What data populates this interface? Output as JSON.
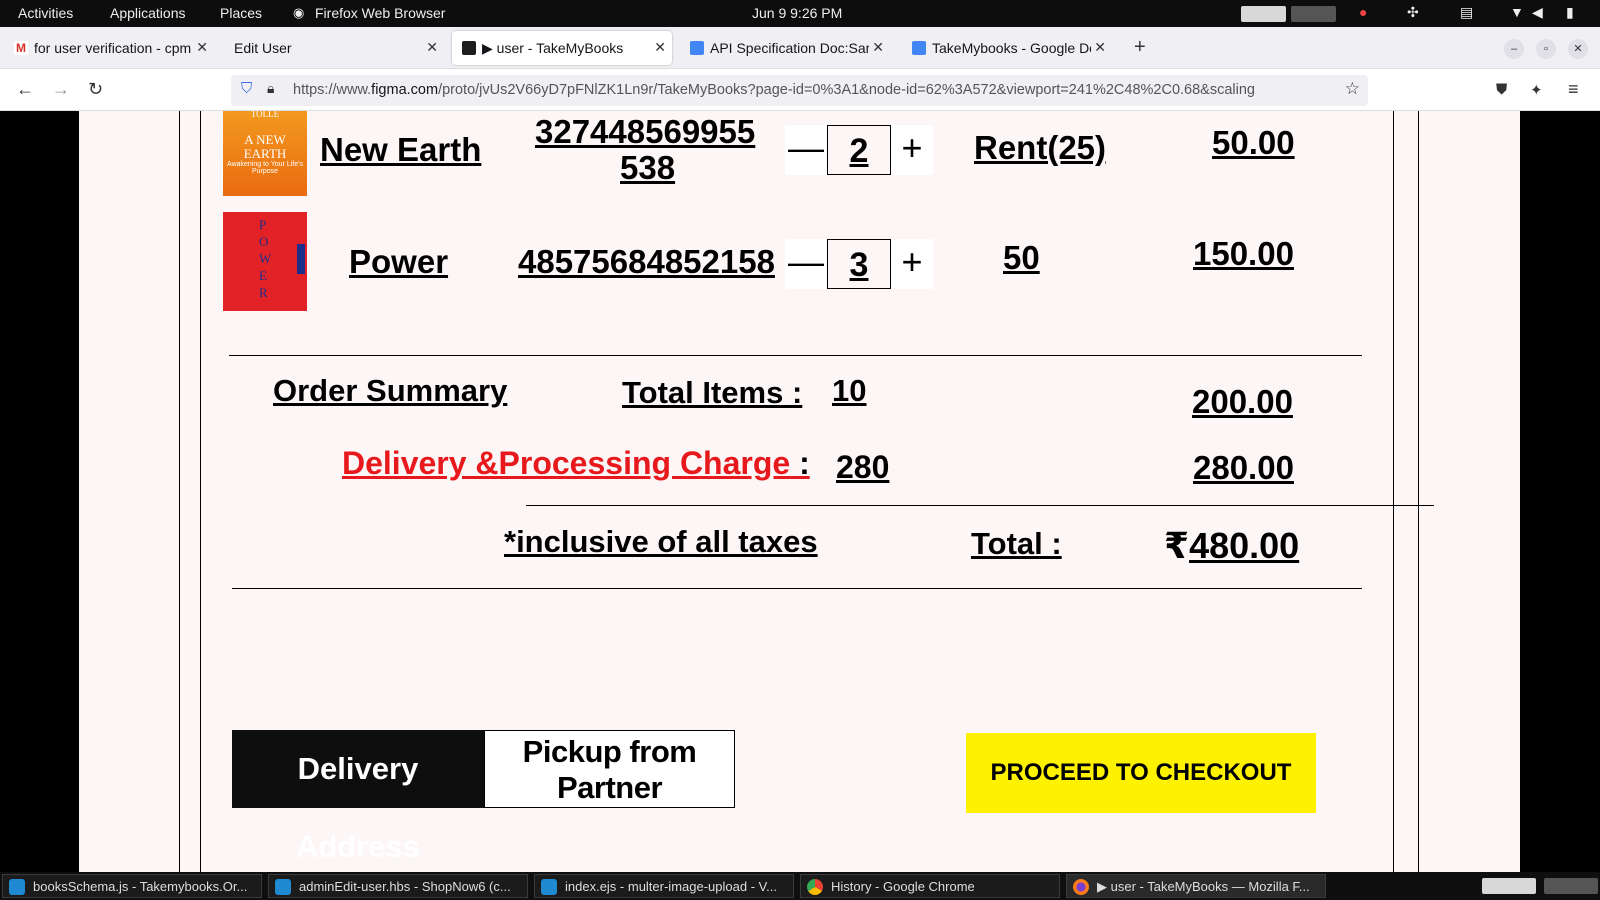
{
  "topbar": {
    "activities": "Activities",
    "applications": "Applications",
    "places": "Places",
    "app_name": "Firefox Web Browser",
    "datetime": "Jun 9  9:26 PM"
  },
  "tabs": [
    {
      "label": "for user verification - cpm",
      "icon": "gmail-icon"
    },
    {
      "label": "Edit User",
      "icon": ""
    },
    {
      "label": "▶ user - TakeMyBooks",
      "icon": "figma-icon"
    },
    {
      "label": "API Specification Doc:Sam",
      "icon": "google-docs-icon"
    },
    {
      "label": "TakeMybooks - Google Do",
      "icon": "google-docs-icon"
    }
  ],
  "navbar": {
    "url_prefix": "https://www.",
    "url_domain": "figma.com",
    "url_rest": "/proto/jvUs2V66yD7pFNlZK1Ln9r/TakeMyBooks?page-id=0%3A1&node-id=62%3A572&viewport=241%2C48%2C0.68&scaling"
  },
  "cart": {
    "items": [
      {
        "title": "New Earth",
        "isbn_line1": "327448569955",
        "isbn_line2": "538",
        "qty": "2",
        "price_label": "Rent(25)",
        "amount": "50.00",
        "cover": {
          "top": "TOLLE",
          "title": "A NEW EARTH",
          "sub": "Awakening to Your Life's Purpose"
        }
      },
      {
        "title": "Power",
        "isbn_line1": "48575684852158",
        "qty": "3",
        "price_label": "50",
        "amount": "150.00",
        "cover": {
          "title": "POWER"
        }
      }
    ],
    "minus": "—",
    "plus": "+"
  },
  "summary": {
    "heading": "Order Summary",
    "total_items_label": "Total Items :",
    "total_items_value": "10",
    "items_amount": "200.00",
    "delivery_label": "Delivery &Processing  Charge",
    "delivery_colon": " :",
    "delivery_value": "280",
    "delivery_amount": "280.00",
    "taxes_note": "*inclusive of all taxes",
    "total_label": "Total :",
    "total_currency": "₹",
    "total_amount": "480.00",
    "delivery_color": "#e8191d"
  },
  "actions": {
    "delivery_address": "Delivery Address",
    "pickup_line1": "Pickup from",
    "pickup_line2": "Partner",
    "checkout": "PROCEED TO CHECKOUT",
    "checkout_color": "#fff200"
  },
  "taskbar": [
    {
      "label": "booksSchema.js - Takemybooks.Or...",
      "icon": "vscode-icon"
    },
    {
      "label": "adminEdit-user.hbs - ShopNow6 (c...",
      "icon": "vscode-icon"
    },
    {
      "label": "index.ejs - multer-image-upload - V...",
      "icon": "vscode-icon"
    },
    {
      "label": "History - Google Chrome",
      "icon": "chrome-icon"
    },
    {
      "label": "▶ user - TakeMyBooks — Mozilla F...",
      "icon": "firefox-icon"
    }
  ]
}
